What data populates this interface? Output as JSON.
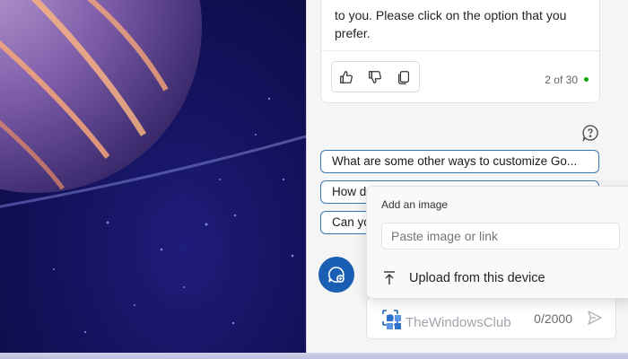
{
  "message": {
    "lines": [
      "to you. Please click on the option that you",
      "prefer."
    ],
    "feedback": {
      "like_icon": "thumbs-up-icon",
      "dislike_icon": "thumbs-down-icon",
      "copy_icon": "copy-icon"
    },
    "page_count": "2 of 30",
    "status_color": "#13a10e"
  },
  "suggestions": [
    "What are some other ways to customize Go...",
    "How d",
    "Can yo"
  ],
  "popup": {
    "title": "Add an image",
    "paste_placeholder": "Paste image or link",
    "upload_label": "Upload from this device"
  },
  "composer": {
    "char_count": "0/2000",
    "accent_color": "#1a5fb4"
  },
  "watermark": "TheWindowsClub"
}
